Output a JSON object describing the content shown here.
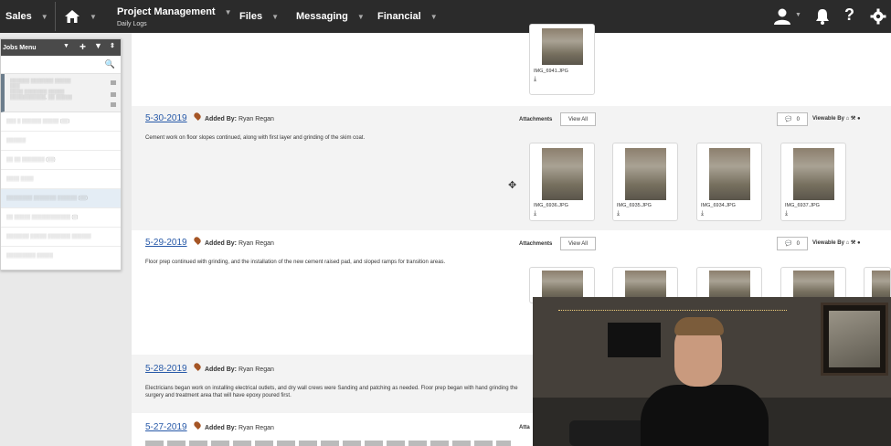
{
  "nav": {
    "sales": "Sales",
    "project_management": "Project Management",
    "project_sub": "Daily Logs",
    "files": "Files",
    "messaging": "Messaging",
    "financial": "Financial"
  },
  "sidebar": {
    "title": "Jobs Menu",
    "search_icon": "🔍"
  },
  "entries": [
    {
      "date": "5-30-2019",
      "added_label": "Added By:",
      "added_by": "Ryan Regan",
      "description": "Cement work on floor slopes continued, along with first layer and grinding of the skim coat.",
      "attachments_label": "Attachments",
      "view_all": "View All",
      "comment_count": "0",
      "viewable_label": "Viewable By",
      "thumbnails": [
        "IMG_6936.JPG",
        "IMG_6935.JPG",
        "IMG_6934.JPG",
        "IMG_6937.JPG"
      ]
    },
    {
      "date": "5-29-2019",
      "added_label": "Added By:",
      "added_by": "Ryan Regan",
      "description": "Floor prep continued with grinding, and the installation of the new cement raised pad, and sloped ramps for transition areas.",
      "attachments_label": "Attachments",
      "view_all": "View All",
      "comment_count": "0",
      "viewable_label": "Viewable By"
    },
    {
      "date": "5-28-2019",
      "added_label": "Added By:",
      "added_by": "Ryan Regan",
      "description": "Electricians began work on installing electrical outlets, and dry wall crews were Sanding and patching as needed. Floor prep began with hand grinding the surgery and treatment area that will have epoxy poured first."
    },
    {
      "date": "5-27-2019",
      "added_label": "Added By:",
      "added_by": "Ryan Regan",
      "attachments_label": "Atta"
    }
  ],
  "top_thumbnail": "IMG_6941.JPG",
  "icons": {
    "home": "home-icon",
    "user": "user-icon",
    "bell": "bell-icon",
    "help": "help-icon",
    "settings": "gear-icon"
  }
}
